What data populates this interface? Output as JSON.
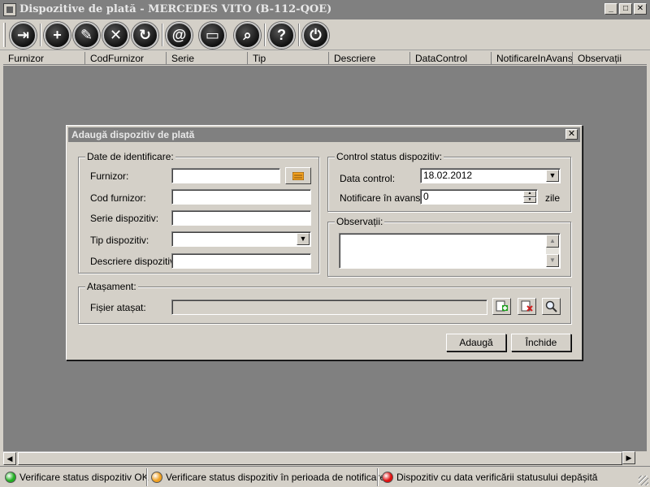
{
  "window": {
    "title": "Dispozitive de plată - MERCEDES VITO (B-112-QOE)",
    "minimize": "_",
    "maximize": "□",
    "close": "✕"
  },
  "toolbar": {
    "buttons": [
      {
        "name": "exit",
        "glyph": "⇥"
      },
      {
        "name": "add",
        "glyph": "+"
      },
      {
        "name": "edit",
        "glyph": "✎"
      },
      {
        "name": "delete",
        "glyph": "✕"
      },
      {
        "name": "refresh",
        "glyph": "↻"
      },
      {
        "name": "email",
        "glyph": "@"
      },
      {
        "name": "print",
        "glyph": "▭"
      },
      {
        "name": "search",
        "glyph": "⌕"
      },
      {
        "name": "help",
        "glyph": "?"
      },
      {
        "name": "power",
        "glyph": "⏻"
      }
    ]
  },
  "grid": {
    "columns": [
      "Furnizor",
      "CodFurnizor",
      "Serie",
      "Tip",
      "Descriere",
      "DataControl",
      "NotificareInAvans",
      "Observații"
    ]
  },
  "scrollbar": {
    "left": "◀",
    "right": "▶"
  },
  "dialog": {
    "title": "Adaugă dispozitiv de plată",
    "close": "✕",
    "identification": {
      "label": "Date de identificare:",
      "furnizor_label": "Furnizor:",
      "furnizor_value": "",
      "cod_label": "Cod furnizor:",
      "cod_value": "",
      "serie_label": "Serie dispozitiv:",
      "serie_value": "",
      "tip_label": "Tip dispozitiv:",
      "tip_value": "",
      "descriere_label": "Descriere dispozitiv:",
      "descriere_value": ""
    },
    "status": {
      "label": "Control status dispozitiv:",
      "data_label": "Data control:",
      "data_value": "18.02.2012",
      "notif_label": "Notificare în avans:",
      "notif_value": "0",
      "notif_unit": "zile"
    },
    "observatii": {
      "label": "Observații:",
      "value": ""
    },
    "atasament": {
      "label": "Atașament:",
      "file_label": "Fișier atașat:",
      "file_value": ""
    },
    "buttons": {
      "add": "Adaugă",
      "close": "Închide"
    }
  },
  "status_bar": {
    "items": [
      {
        "color": "#22b022",
        "text": "Verificare status dispozitiv OK"
      },
      {
        "color": "#f0a020",
        "text": "Verificare status dispozitiv în perioada de notificare"
      },
      {
        "color": "#e01010",
        "text": "Dispozitiv cu data verificării statusului depășită"
      }
    ]
  },
  "colors": {
    "face": "#d4d0c8",
    "title_inactive": "#808080",
    "grid_bg": "#808080"
  }
}
